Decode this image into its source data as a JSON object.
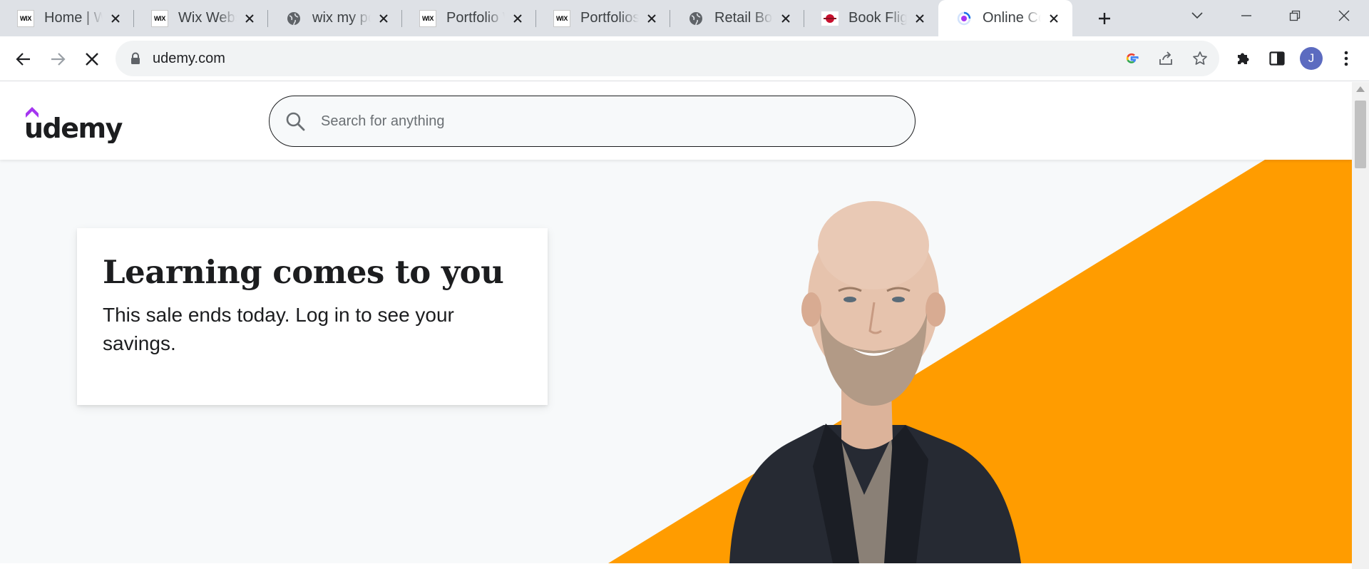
{
  "browser": {
    "tabs": [
      {
        "title": "Home | Wix",
        "favicon": "wix-icon",
        "active": false
      },
      {
        "title": "Wix Website",
        "favicon": "wix-icon",
        "active": false
      },
      {
        "title": "wix my portfolio",
        "favicon": "globe-icon",
        "active": false
      },
      {
        "title": "Portfolio Website",
        "favicon": "wix-icon",
        "active": false
      },
      {
        "title": "Portfolios Website",
        "favicon": "wix-icon",
        "active": false
      },
      {
        "title": "Retail Box Packaging",
        "favicon": "globe-icon",
        "active": false
      },
      {
        "title": "Book Flights",
        "favicon": "airline-icon",
        "active": false
      },
      {
        "title": "Online Courses",
        "favicon": "loading-spinner-icon",
        "active": true
      }
    ],
    "wix_favicon_text": "WIX",
    "address_bar": {
      "url": "udemy.com"
    },
    "profile_initial": "J",
    "colors": {
      "tabstrip": "#dee1e6",
      "omnibox": "#f1f3f4",
      "avatar": "#5c6bc0"
    }
  },
  "site": {
    "logo_text": "udemy",
    "search": {
      "placeholder": "Search for anything"
    },
    "hero": {
      "title": "Learning comes to you",
      "subtitle": "This sale ends today. Log in to see your savings."
    },
    "colors": {
      "brand_purple": "#a435f0",
      "accent_orange": "#ff9c00",
      "text": "#1c1d1f",
      "hero_bg": "#f7f9fa"
    }
  }
}
